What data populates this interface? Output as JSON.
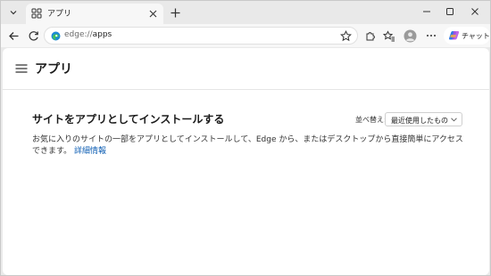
{
  "tab": {
    "title": "アプリ",
    "close_label": "×"
  },
  "toolbar": {
    "url_scheme": "edge://",
    "url_path": "apps",
    "copilot_label": "チャット"
  },
  "page": {
    "title": "アプリ",
    "section_title": "サイトをアプリとしてインストールする",
    "sort": {
      "label": "並べ替え:",
      "value": "最近使用したもの"
    },
    "description": "お気に入りのサイトの一部をアプリとしてインストールして、Edge から、またはデスクトップから直接簡単にアクセスできます。",
    "details_link": "詳細情報"
  },
  "colors": {
    "accent": "#0f5fb4",
    "page_bg": "#ffffff",
    "chrome_bg": "#e9e9e9"
  },
  "icons": [
    "tab-actions-icon",
    "apps-icon",
    "close-icon",
    "plus-icon",
    "minimize-icon",
    "maximize-icon",
    "window-close-icon",
    "back-icon",
    "refresh-icon",
    "edge-icon",
    "star-icon",
    "extensions-icon",
    "favorites-icon",
    "profile-icon",
    "more-icon",
    "copilot-icon",
    "hamburger-icon",
    "chevron-down-icon"
  ]
}
